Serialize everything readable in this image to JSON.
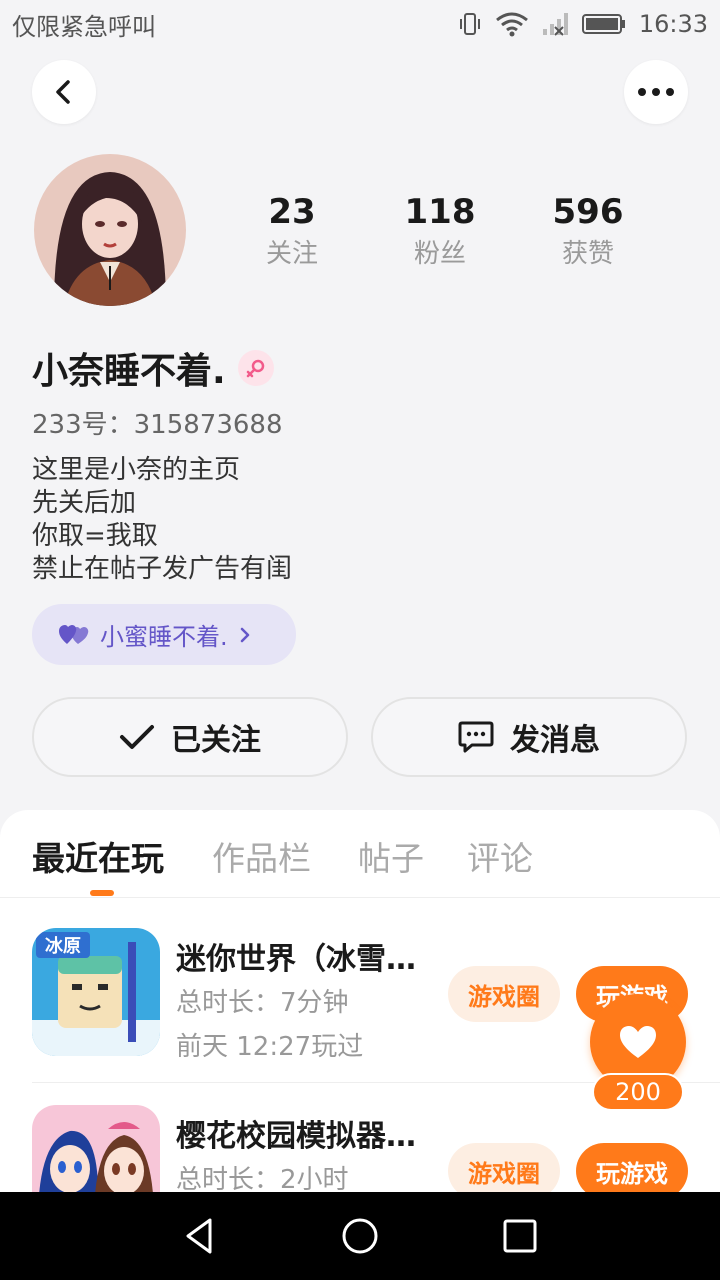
{
  "status_bar": {
    "carrier": "仅限紧急呼叫",
    "time": "16:33",
    "icons": [
      "vibrate-icon",
      "wifi-icon",
      "signal-icon",
      "battery-icon"
    ]
  },
  "header": {
    "back_icon": "chevron-left-icon",
    "more_icon": "more-horizontal-icon"
  },
  "profile": {
    "stats": [
      {
        "value": "23",
        "label": "关注"
      },
      {
        "value": "118",
        "label": "粉丝"
      },
      {
        "value": "596",
        "label": "获赞"
      }
    ],
    "name": "小奈睡不着.",
    "gender_icon": "female-icon",
    "id_line": "233号：315873688",
    "bio": [
      "这里是小奈的主页",
      "先关后加",
      "你取=我取",
      "禁止在帖子发广告有闺"
    ],
    "cp_label": "小蜜睡不着."
  },
  "actions": {
    "follow_label": "已关注",
    "message_label": "发消息"
  },
  "tabs": [
    {
      "label": "最近在玩",
      "active": true
    },
    {
      "label": "作品栏",
      "active": false
    },
    {
      "label": "帖子",
      "active": false
    },
    {
      "label": "评论",
      "active": false
    }
  ],
  "games": [
    {
      "title": "迷你世界（冰雪…",
      "duration": "总时长：7分钟",
      "last_played": "前天 12:27玩过",
      "circle_label": "游戏圈",
      "play_label": "玩游戏",
      "icon_text": "冰原"
    },
    {
      "title": "樱花校园模拟器…",
      "duration": "总时长：2小时",
      "circle_label": "游戏圈",
      "play_label": "玩游戏"
    }
  ],
  "like": {
    "count": "200"
  },
  "colors": {
    "accent": "#ff7a1a",
    "accent_light": "#fdeee2",
    "cp_bg": "#e6e4f6",
    "cp_text": "#6456c8",
    "background": "#f4f4f6"
  }
}
